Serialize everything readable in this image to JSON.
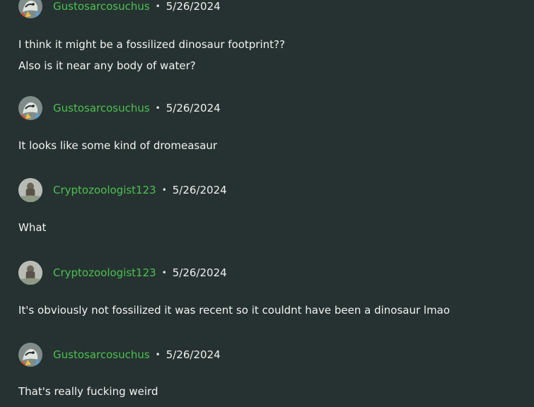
{
  "comments": [
    {
      "author": "Gustosarcosuchus",
      "avatar_icon": "reptile-avatar-icon",
      "date": "5/26/2024",
      "lines": [
        "I think it might be a fossilized dinosaur footprint??",
        "Also is it near any body of water?"
      ]
    },
    {
      "author": "Gustosarcosuchus",
      "avatar_icon": "reptile-avatar-icon",
      "date": "5/26/2024",
      "lines": [
        "It looks like some kind of dromeasaur"
      ]
    },
    {
      "author": "Cryptozoologist123",
      "avatar_icon": "cryptid-avatar-icon",
      "date": "5/26/2024",
      "lines": [
        "What"
      ]
    },
    {
      "author": "Cryptozoologist123",
      "avatar_icon": "cryptid-avatar-icon",
      "date": "5/26/2024",
      "lines": [
        "It's obviously not fossilized it was recent so it couldnt have been a dinosaur lmao"
      ]
    },
    {
      "author": "Gustosarcosuchus",
      "avatar_icon": "reptile-avatar-icon",
      "date": "5/26/2024",
      "lines": [
        "That's really fucking weird"
      ]
    }
  ],
  "separator": "•",
  "colors": {
    "background": "#263231",
    "username": "#4cc052",
    "text": "#eef0ee"
  }
}
